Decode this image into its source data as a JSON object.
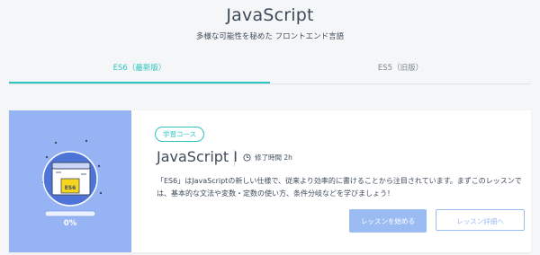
{
  "header": {
    "title": "JavaScript",
    "subtitle": "多様な可能性を秘めた フロントエンド言語"
  },
  "tabs": [
    {
      "label": "ES6（最新版）",
      "active": true
    },
    {
      "label": "ES5（旧版）",
      "active": false
    }
  ],
  "course": {
    "tag": "学習コース",
    "title": "JavaScript I",
    "duration": "修了時間 2h",
    "duration_icon": "clock-icon",
    "description": "「ES6」はJavaScriptの新しい仕様で、従来より効率的に書けることから注目されています。まずこのレッスンでは、基本的な文法や変数・定数の使い方、条件分岐などを学びましょう！",
    "thumbnail_label": "ES6",
    "progress_percent": 0,
    "progress_text": "0%",
    "start_button": "レッスンを始める",
    "detail_button": "レッスン詳細へ"
  },
  "colors": {
    "accent": "#2cc5c0",
    "thumbnail_bg": "#96b4f4",
    "button_blue": "#9bbcf3",
    "text": "#3d4a5a"
  }
}
